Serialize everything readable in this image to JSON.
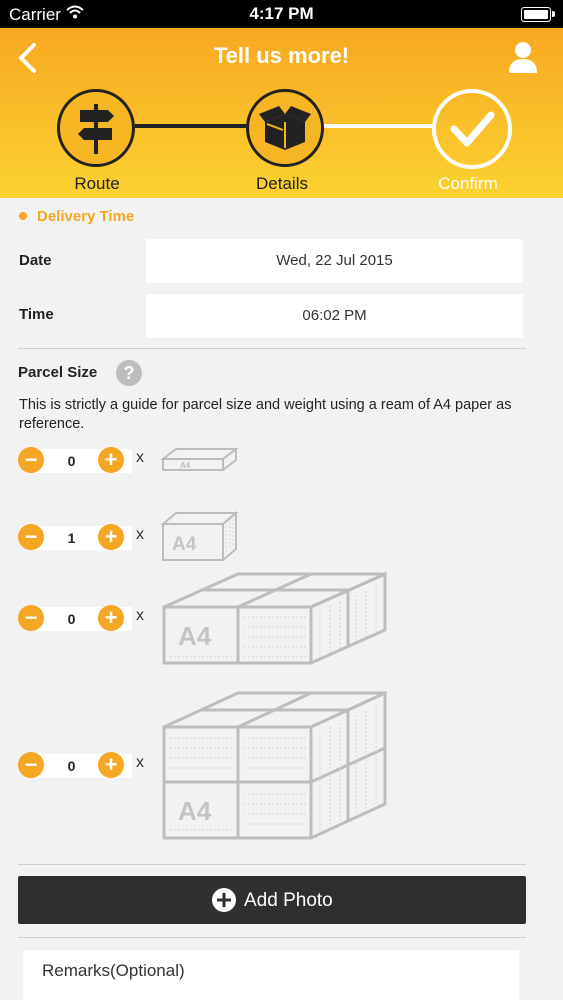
{
  "status_bar": {
    "carrier": "Carrier",
    "time": "4:17 PM"
  },
  "header": {
    "title": "Tell us more!"
  },
  "steps": [
    {
      "label": "Route",
      "state": "done"
    },
    {
      "label": "Details",
      "state": "done"
    },
    {
      "label": "Confirm",
      "state": "active"
    }
  ],
  "delivery": {
    "section_title": "Delivery Time",
    "date_label": "Date",
    "date_value": "Wed, 22 Jul 2015",
    "time_label": "Time",
    "time_value": "06:02 PM"
  },
  "parcel": {
    "title": "Parcel Size",
    "help_icon": "?",
    "description": "This is strictly a guide for parcel size and weight using a ream of A4 paper as reference.",
    "multiplier": "x",
    "sizes": [
      {
        "quantity": "0",
        "box_label": "A4"
      },
      {
        "quantity": "1",
        "box_label": "A4"
      },
      {
        "quantity": "0",
        "box_label": "A4"
      },
      {
        "quantity": "0",
        "box_label": "A4"
      }
    ]
  },
  "add_photo": {
    "label": "Add Photo"
  },
  "remarks": {
    "placeholder": "Remarks(Optional)"
  },
  "colors": {
    "accent": "#f5a623",
    "header_top": "#f7a821",
    "header_bottom": "#fbd231",
    "dark": "#2f2f2f"
  }
}
